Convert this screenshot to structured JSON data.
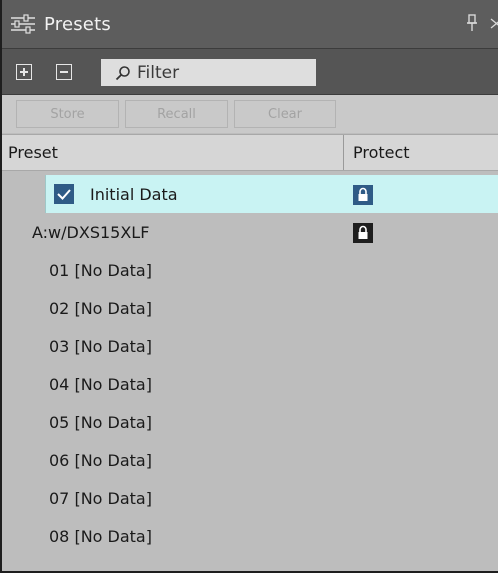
{
  "window": {
    "title": "Presets"
  },
  "toolbar": {
    "filter_placeholder": "Filter"
  },
  "actions": {
    "store": "Store",
    "recall": "Recall",
    "clear": "Clear"
  },
  "columns": {
    "preset": "Preset",
    "protect": "Protect"
  },
  "rows": [
    {
      "label": "Initial Data",
      "selected": true,
      "checked": true,
      "protected": true
    },
    {
      "label": "A:w/DXS15XLF",
      "protected": true
    },
    {
      "label": "01 [No Data]"
    },
    {
      "label": "02 [No Data]"
    },
    {
      "label": "03 [No Data]"
    },
    {
      "label": "04 [No Data]"
    },
    {
      "label": "05 [No Data]"
    },
    {
      "label": "06 [No Data]"
    },
    {
      "label": "07 [No Data]"
    },
    {
      "label": "08 [No Data]"
    }
  ],
  "colors": {
    "title_bg": "#5d5d5d",
    "selection": "#c9f3f3",
    "checkbox": "#2f5b86",
    "lock_selected": "#2f5b86",
    "lock_normal": "#1e1e1e"
  }
}
